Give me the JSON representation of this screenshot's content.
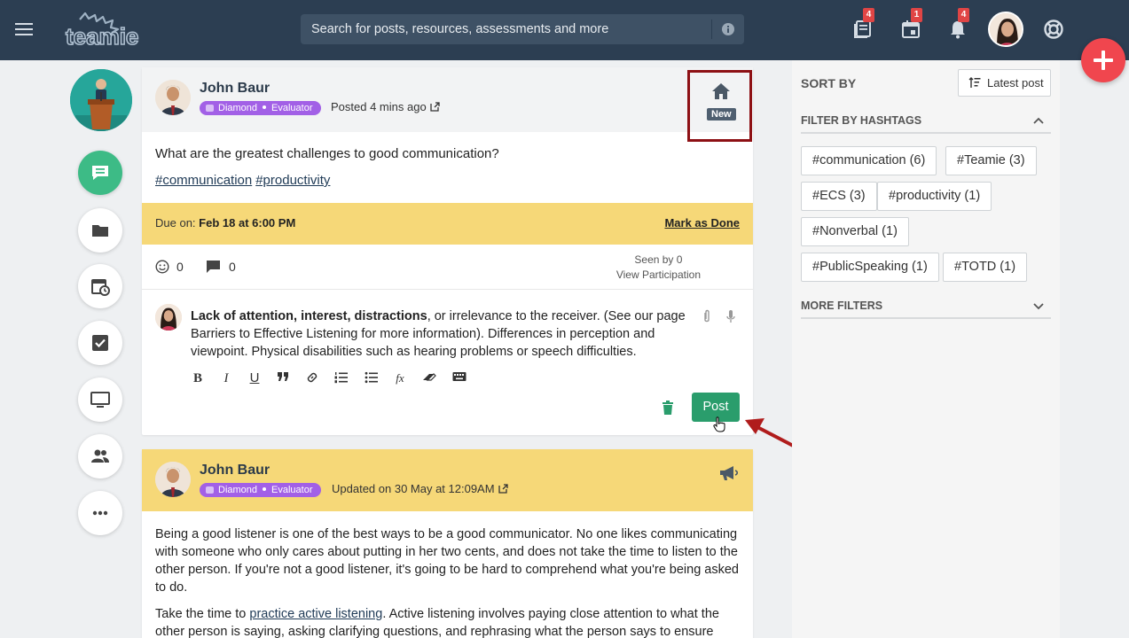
{
  "topbar": {
    "logo_text": "teamie",
    "search_placeholder": "Search for posts, resources, assessments and more",
    "badges": {
      "books": "4",
      "calendar": "1",
      "notifications": "4"
    }
  },
  "post1": {
    "author": "John Baur",
    "role_level": "Diamond",
    "role_type": "Evaluator",
    "posted": "Posted 4 mins ago",
    "new_label": "New",
    "question": "What are the greatest challenges to good communication?",
    "hashtags": [
      "#communication",
      "#productivity"
    ],
    "due_label": "Due on:",
    "due_value": "Feb 18 at 6:00 PM",
    "mark_done": "Mark as Done",
    "reactions": "0",
    "comments": "0",
    "seen_by": "Seen by 0",
    "view_participation": "View Participation",
    "reply_bold": "Lack of attention, interest, distractions",
    "reply_rest": ", or irrelevance to the receiver. (See our page Barriers to Effective Listening for more information). Differences in perception and viewpoint. Physical disabilities such as hearing problems or speech difficulties.",
    "post_button": "Post"
  },
  "post2": {
    "author": "John Baur",
    "role_level": "Diamond",
    "role_type": "Evaluator",
    "updated": "Updated on 30 May at 12:09AM",
    "paragraph1": "Being a good listener is one of the best ways to be a good communicator. No one likes communicating with someone who only cares about putting in her two cents, and does not take the time to listen to the other person. If you're not a good listener, it's going to be hard to comprehend what you're being asked to do.",
    "paragraph2_start": "Take the time to ",
    "paragraph2_link": "practice active listening",
    "paragraph2_rest": ". Active listening involves paying close attention to what the other person is saying, asking clarifying questions, and rephrasing what the person says to ensure"
  },
  "sidebar": {
    "sort_by": "SORT BY",
    "sort_button": "Latest post",
    "filter_hashtags": "FILTER BY HASHTAGS",
    "tags": [
      "#communication (6)",
      "#Teamie (3)",
      "#ECS (3)",
      "#productivity (1)",
      "#Nonverbal (1)",
      "#PublicSpeaking (1)",
      "#TOTD (1)"
    ],
    "more_filters": "MORE FILTERS"
  },
  "colors": {
    "topbar": "#2c3e52",
    "accent_green": "#2a9d6c",
    "due_yellow": "#f6d878",
    "role_purple": "#a260e6",
    "fab_red": "#f0464e"
  },
  "icons": [
    "menu-icon",
    "info-icon",
    "books-icon",
    "calendar-icon",
    "bell-icon",
    "help-icon",
    "plus-icon",
    "chat-icon",
    "folder-icon",
    "schedule-icon",
    "checkbox-icon",
    "monitor-icon",
    "people-icon",
    "more-icon",
    "home-icon",
    "megaphone-icon",
    "trash-icon"
  ]
}
